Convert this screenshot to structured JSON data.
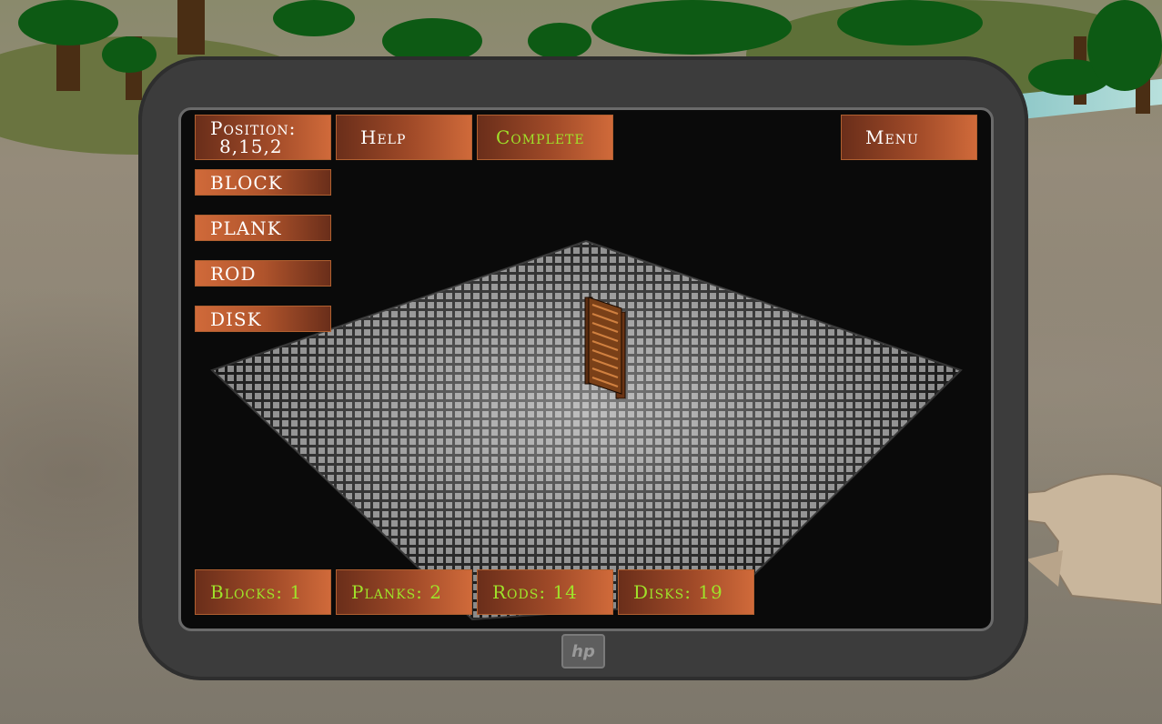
{
  "hud": {
    "position_label": "Position:",
    "position_value": "8,15,2",
    "help": "Help",
    "complete": "Complete",
    "menu": "Menu"
  },
  "tools": {
    "block": "BLOCK",
    "plank": "PLANK",
    "rod": "ROD",
    "disk": "DISK"
  },
  "counts": {
    "blocks": "Blocks: 1",
    "planks": "Planks: 2",
    "rods": "Rods: 14",
    "disks": "Disks: 19"
  },
  "device": {
    "logo": "hp"
  },
  "colors": {
    "button_dark": "#6a2e1a",
    "button_light": "#d06a3a",
    "accent_green": "#9fe22a",
    "bezel": "#3c3c3c"
  }
}
